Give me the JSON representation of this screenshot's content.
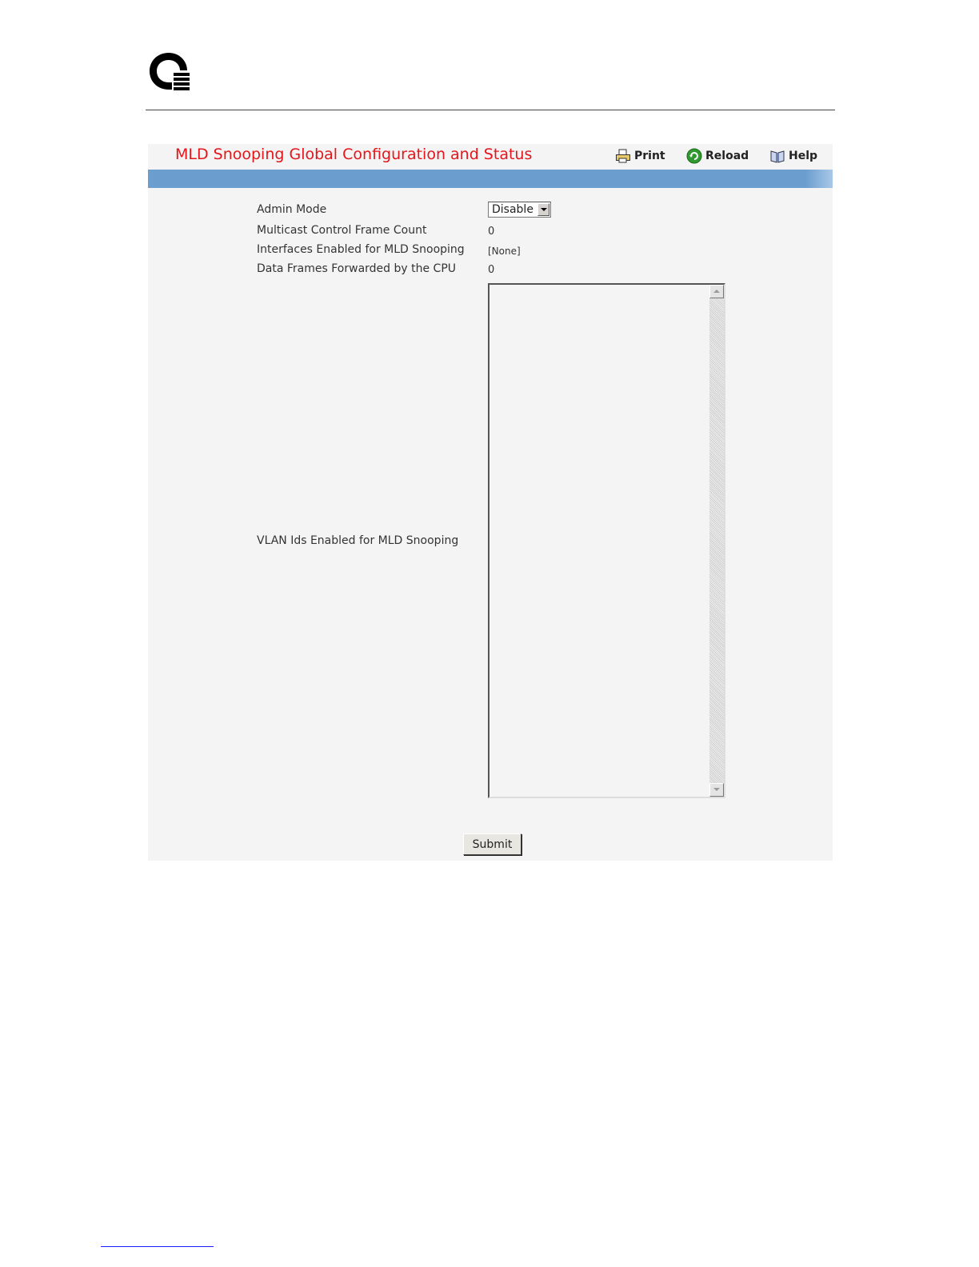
{
  "page": {
    "title": "MLD Snooping Global Configuration and Status"
  },
  "toolbar": {
    "print_label": "Print",
    "reload_label": "Reload",
    "help_label": "Help"
  },
  "fields": {
    "admin_mode": {
      "label": "Admin Mode",
      "selected": "Disable"
    },
    "multicast_control_frame_count": {
      "label": "Multicast Control Frame Count",
      "value": "0"
    },
    "interfaces_enabled": {
      "label": "Interfaces Enabled for MLD Snooping",
      "value": "[None]"
    },
    "data_frames_forwarded": {
      "label": "Data Frames Forwarded by the CPU",
      "value": "0"
    },
    "vlan_ids_enabled": {
      "label": "VLAN Ids Enabled for MLD Snooping",
      "items": []
    }
  },
  "actions": {
    "submit_label": "Submit"
  },
  "colors": {
    "title": "#e3161c",
    "header_bar": "#6b9dce",
    "panel_background": "#f4f4f4"
  },
  "icons": [
    "brand-logo-icon",
    "printer-icon",
    "reload-icon",
    "help-book-icon",
    "dropdown-arrow-icon",
    "scroll-up-icon",
    "scroll-down-icon"
  ]
}
